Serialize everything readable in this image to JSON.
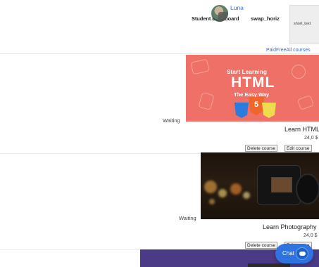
{
  "header": {
    "user_name": "Luna",
    "student_dashboard": "Student Dashboard",
    "swap_label": "swap_horiz",
    "short_text": "short_text"
  },
  "filters": {
    "paid": "Paid",
    "free": "Free",
    "all": "All courses"
  },
  "courses": [
    {
      "status": "Waiting",
      "title": "Learn HTML",
      "price": "24,0 $",
      "thumb": {
        "line1": "Start Learning",
        "line2": "HTML",
        "line3": "The Easy Way",
        "html_badge": "5"
      },
      "delete_label": "Delete course",
      "edit_label": "Edit course"
    },
    {
      "status": "Waiting",
      "title": "Learn Photography",
      "price": "24,0 $",
      "delete_label": "Delete course",
      "edit_label": "Edit course"
    }
  ],
  "chat": {
    "label": "Chat",
    "icon": "chat-bubble-icon"
  },
  "colors": {
    "link": "#3b6fd8",
    "html_card": "#ef7066",
    "chat": "#2f73e0",
    "course3_card": "#4b3a86"
  }
}
